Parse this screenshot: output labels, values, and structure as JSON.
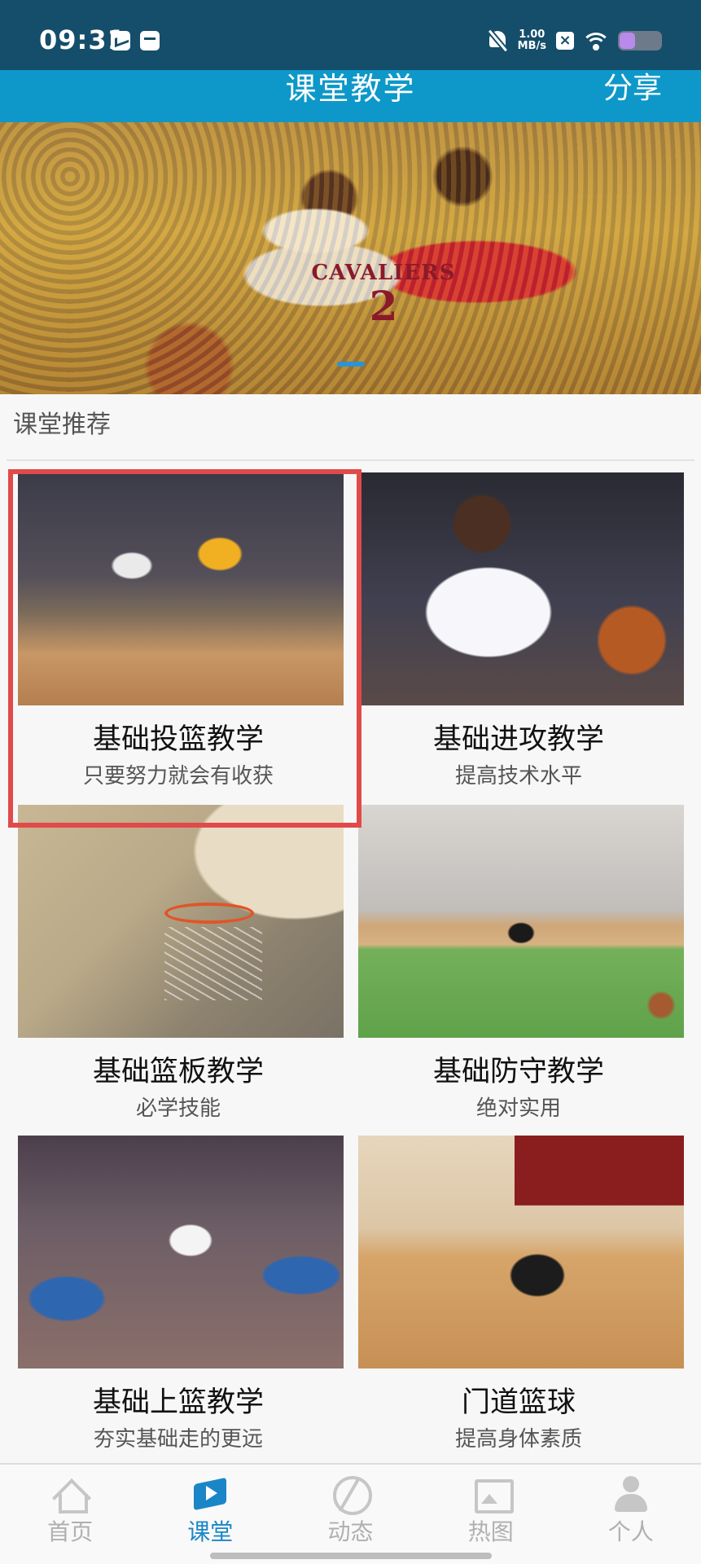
{
  "status_bar": {
    "time": "09:31",
    "net_speed_value": "1.00",
    "net_speed_unit": "MB/s",
    "battery_level": 0.35,
    "battery_color": "#b88bea"
  },
  "header": {
    "title": "课堂教学",
    "share": "分享",
    "bg_color": "#0d98c9"
  },
  "banner": {
    "jersey_name": "CAVALIERS",
    "jersey_number": "2"
  },
  "section": {
    "title": "课堂推荐"
  },
  "courses": [
    {
      "title": "基础投篮教学",
      "subtitle": "只要努力就会有收获",
      "selected": true
    },
    {
      "title": "基础进攻教学",
      "subtitle": "提高技术水平",
      "selected": false
    },
    {
      "title": "基础篮板教学",
      "subtitle": "必学技能",
      "selected": false
    },
    {
      "title": "基础防守教学",
      "subtitle": "绝对实用",
      "selected": false
    },
    {
      "title": "基础上篮教学",
      "subtitle": "夯实基础走的更远",
      "selected": false
    },
    {
      "title": "门道篮球",
      "subtitle": "提高身体素质",
      "selected": false
    }
  ],
  "bottom_nav": [
    {
      "label": "首页",
      "icon": "home-icon",
      "active": false
    },
    {
      "label": "课堂",
      "icon": "classroom-icon",
      "active": true
    },
    {
      "label": "动态",
      "icon": "basketball-icon",
      "active": false
    },
    {
      "label": "热图",
      "icon": "picture-icon",
      "active": false
    },
    {
      "label": "个人",
      "icon": "person-icon",
      "active": false
    }
  ],
  "colors": {
    "accent": "#1a86c8",
    "selection_frame": "#e14a4a",
    "status_bar": "#154e6a"
  }
}
